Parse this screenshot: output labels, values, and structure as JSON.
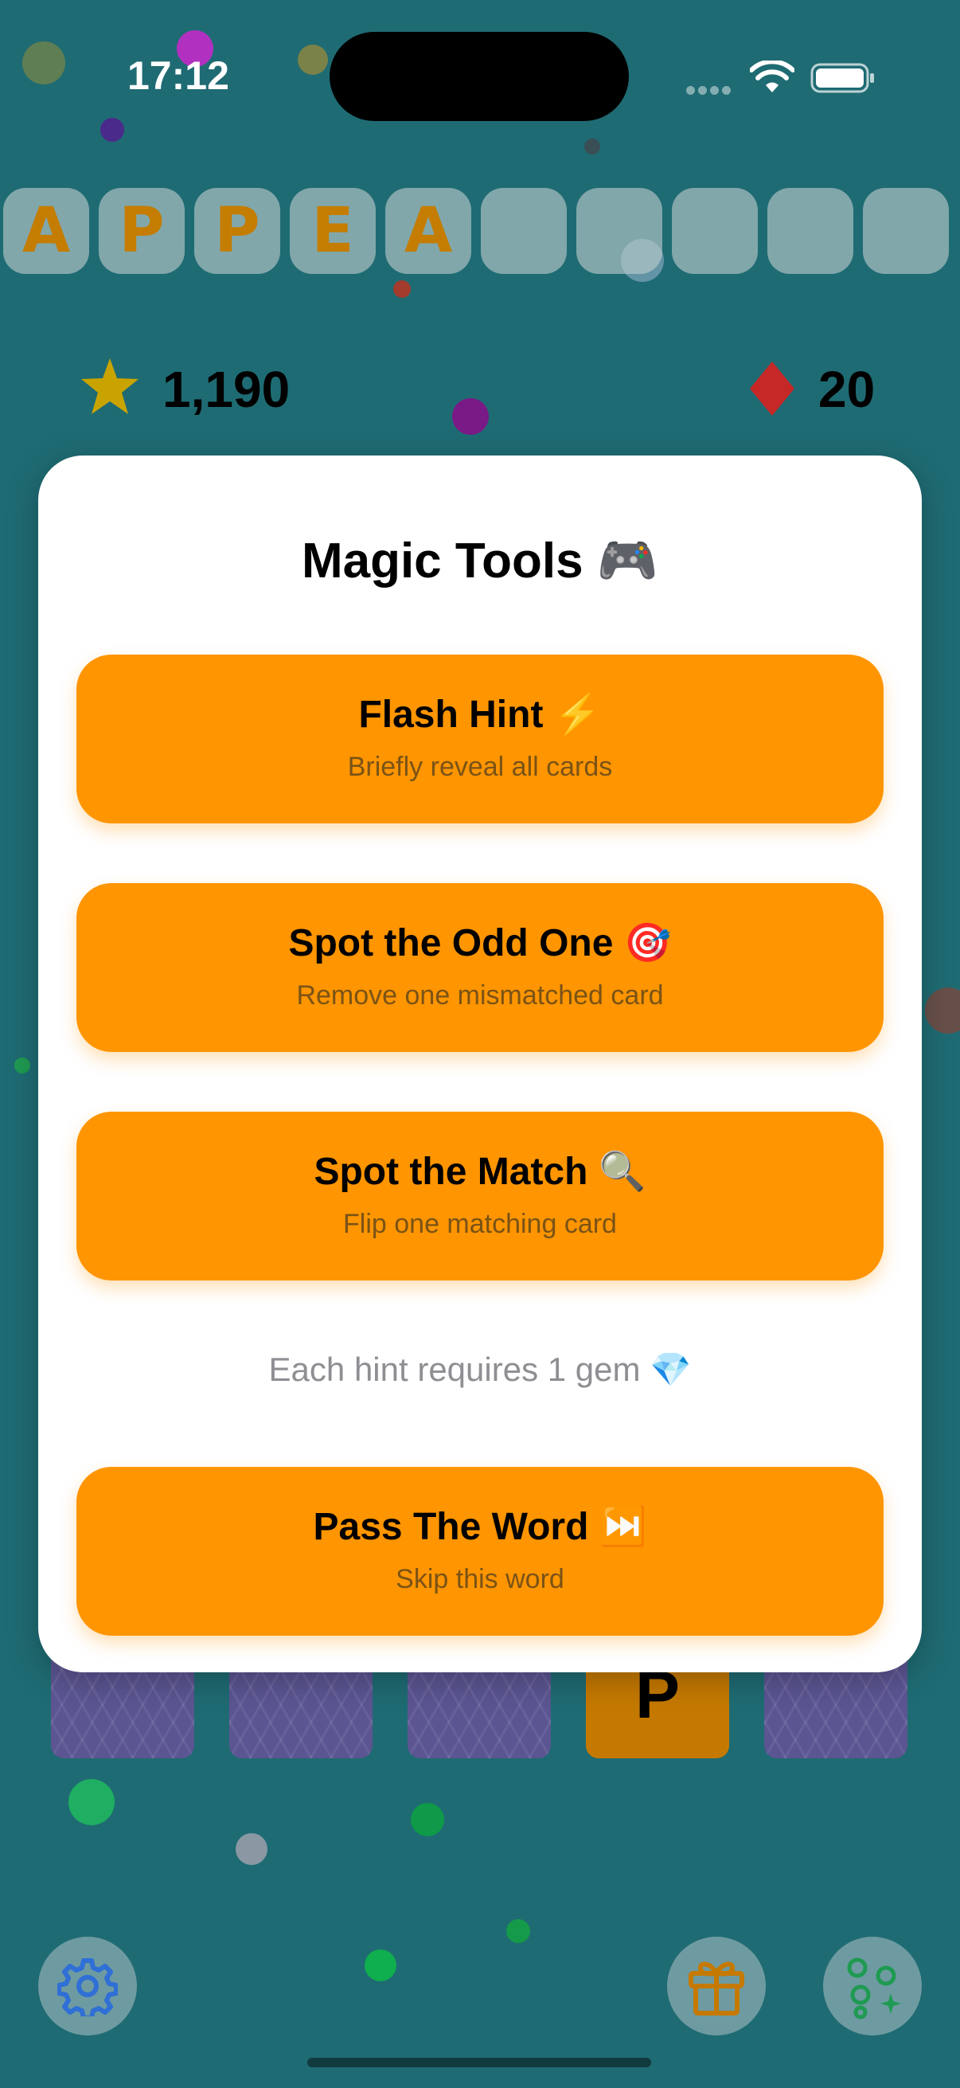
{
  "status_bar": {
    "time": "17:12"
  },
  "word": {
    "letters": [
      "A",
      "P",
      "P",
      "E",
      "A",
      "",
      "",
      "",
      "",
      ""
    ]
  },
  "stats": {
    "score": "1,190",
    "gems": "20"
  },
  "modal": {
    "title": "Magic Tools 🎮",
    "tools": [
      {
        "title": "Flash Hint ⚡️",
        "subtitle": "Briefly reveal all cards"
      },
      {
        "title": "Spot the Odd One 🎯",
        "subtitle": "Remove one mismatched card"
      },
      {
        "title": "Spot the Match 🔍",
        "subtitle": "Flip one matching card"
      }
    ],
    "cost_note": "Each hint requires 1 gem 💎",
    "skip": {
      "title": "Pass The Word ⏭️",
      "subtitle": "Skip this word"
    }
  },
  "board": {
    "revealed_card_letter": "P"
  },
  "icons": {
    "settings": "gear-icon",
    "gift": "gift-icon",
    "tools": "sparkles-icon",
    "score": "star-icon",
    "gems": "diamond-icon"
  },
  "colors": {
    "background": "#1f6b73",
    "accent": "#ff9500",
    "tile_letter": "#c47d00",
    "star": "#c9a400",
    "gem": "#c62828"
  }
}
